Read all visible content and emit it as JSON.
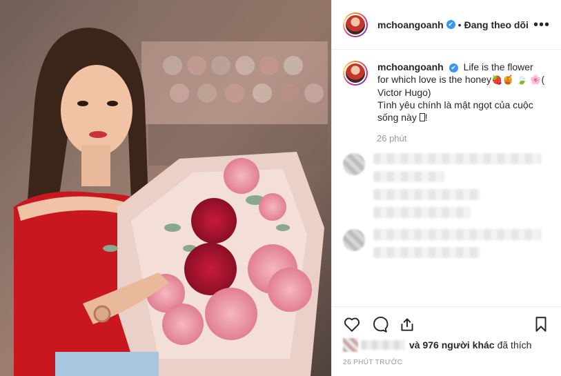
{
  "header": {
    "username": "mchoangoanh",
    "verified_mark": "✔",
    "separator": "•",
    "follow_label": "Đang theo dõi",
    "more_label": "•••"
  },
  "caption": {
    "username": "mchoangoanh",
    "verified_mark": "✔",
    "text_1": "Life is the flower for which love is the honey",
    "emoji_1": "🍓",
    "emoji_2": "🍯",
    "emoji_3": "🍃",
    "emoji_4": "🌸",
    "text_2": "( Victor Hugo)",
    "text_3": "Tình yêu chính là mật ngọt của cuộc sống này",
    "text_4": "!"
  },
  "time_ago": "26 phút",
  "icons": {
    "like": "heart-icon",
    "comment": "comment-icon",
    "share": "share-icon",
    "save": "bookmark-icon"
  },
  "likes": {
    "count_text": "và 976 người khác",
    "suffix": "đã thích"
  },
  "timestamp": "26 PHÚT TRƯỚC",
  "colors": {
    "accent": "#3897f0",
    "text": "#262626",
    "muted": "#999999",
    "border": "#efefef"
  }
}
